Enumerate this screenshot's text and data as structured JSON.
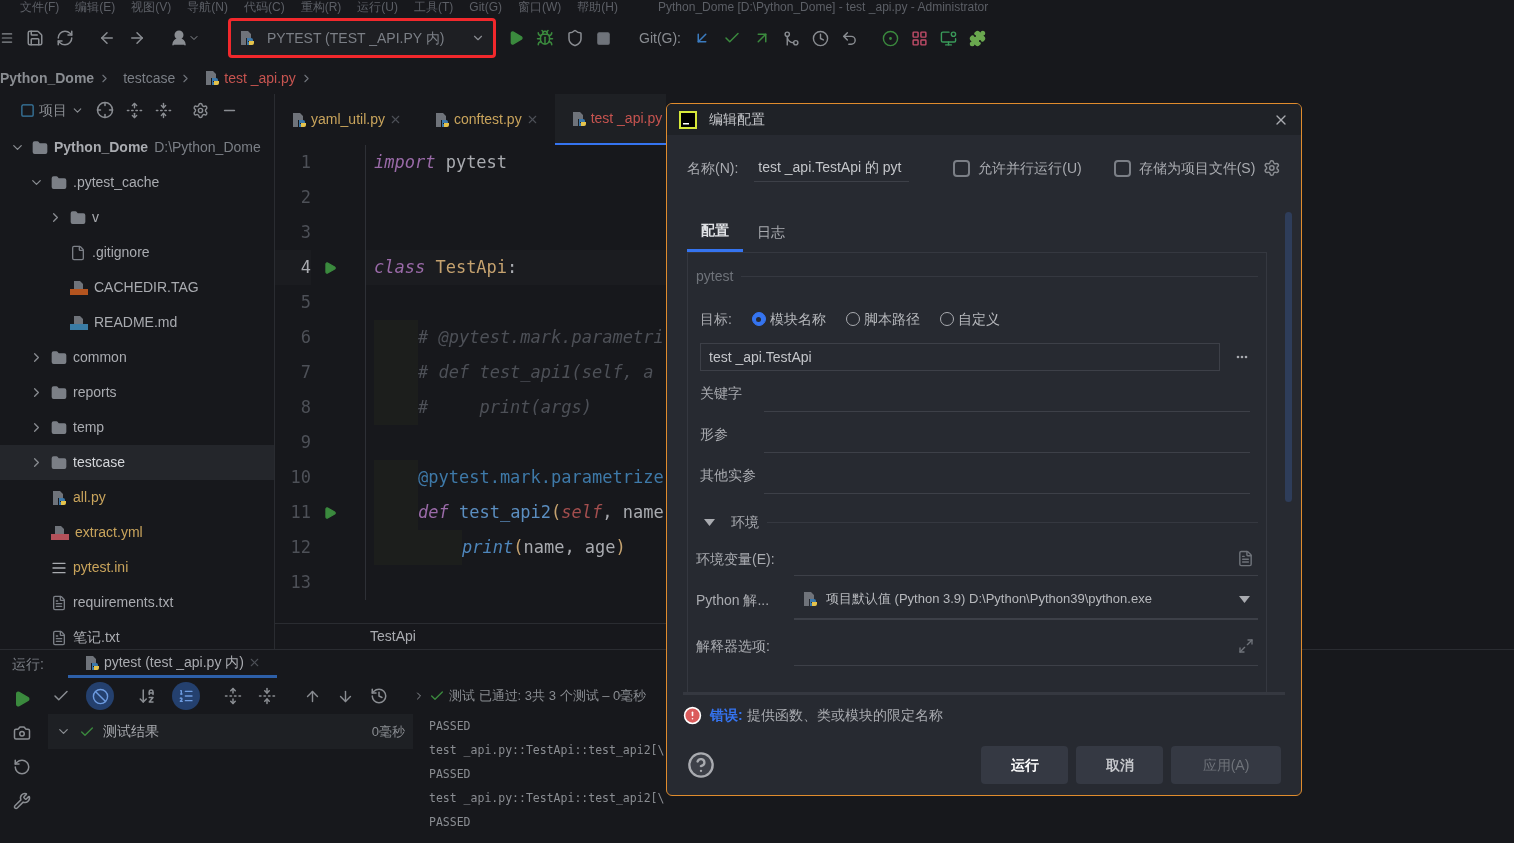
{
  "menu": {
    "items": [
      "文件(F)",
      "编辑(E)",
      "视图(V)",
      "导航(N)",
      "代码(C)",
      "重构(R)",
      "运行(U)",
      "工具(T)",
      "Git(G)",
      "窗口(W)",
      "帮助(H)"
    ],
    "title": "Python_Dome [D:\\Python_Dome] - test _api.py - Administrator"
  },
  "toolbar": {
    "run_config": {
      "label": "PYTEST (TEST _API.PY 内)",
      "highlighted": true
    },
    "git_label": "Git(G):"
  },
  "breadcrumbs": [
    {
      "label": "Python_Dome",
      "kind": "project"
    },
    {
      "label": "testcase",
      "kind": "folder"
    },
    {
      "label": "test _api.py",
      "kind": "file"
    }
  ],
  "project_panel": {
    "title": "项目",
    "tree": [
      {
        "name": "Python_Dome",
        "path": "D:\\Python_Dome",
        "kind": "root",
        "expanded": true,
        "selected": false,
        "children": [
          {
            "name": ".pytest_cache",
            "kind": "folder",
            "expanded": true,
            "selected": false,
            "children": [
              {
                "name": "v",
                "kind": "folder",
                "expanded": false,
                "selected": false
              },
              {
                "name": ".gitignore",
                "kind": "ignore",
                "color": "#a9abb0",
                "selected": false
              },
              {
                "name": "CACHEDIR.TAG",
                "kind": "jsp",
                "color": "#a9abb0",
                "selected": false
              },
              {
                "name": "README.md",
                "kind": "md",
                "color": "#a9abb0",
                "selected": false
              }
            ]
          },
          {
            "name": "common",
            "kind": "package",
            "expanded": false,
            "selected": false
          },
          {
            "name": "reports",
            "kind": "folder",
            "expanded": false,
            "selected": false
          },
          {
            "name": "temp",
            "kind": "package",
            "expanded": false,
            "selected": false
          },
          {
            "name": "testcase",
            "kind": "package",
            "expanded": false,
            "selected": true
          },
          {
            "name": "all.py",
            "kind": "python",
            "color": "#c9a45c",
            "selected": false
          },
          {
            "name": "extract.yml",
            "kind": "yml",
            "color": "#c9a45c",
            "selected": false
          },
          {
            "name": "pytest.ini",
            "kind": "ini",
            "color": "#c9a45c",
            "selected": false
          },
          {
            "name": "requirements.txt",
            "kind": "txt",
            "color": "#a9abb0",
            "selected": false
          },
          {
            "name": "笔记.txt",
            "kind": "txt",
            "color": "#a9abb0",
            "selected": false
          }
        ]
      }
    ]
  },
  "editor": {
    "tabs": [
      {
        "label": "yaml_util.py",
        "selected": false,
        "color": "#c9a45c"
      },
      {
        "label": "conftest.py",
        "selected": false,
        "color": "#c9a45c"
      },
      {
        "label": "test _api.py",
        "selected": true,
        "color": "#c75450"
      }
    ],
    "lines": [
      {
        "number": "1",
        "run": false,
        "current": false,
        "kind": "top",
        "tokens": [
          {
            "kind": "keyword",
            "text": "import"
          },
          {
            "kind": "plain",
            "text": " pytest"
          }
        ]
      },
      {
        "number": "2",
        "run": false,
        "current": false,
        "kind": "top"
      },
      {
        "number": "3",
        "run": false,
        "current": false,
        "kind": "top"
      },
      {
        "number": "4",
        "run": true,
        "current": true,
        "kind": "top",
        "tokens": [
          {
            "kind": "keyword",
            "text": "class"
          },
          {
            "kind": "class",
            "text": " TestApi"
          },
          {
            "kind": "plain",
            "text": ":"
          }
        ]
      },
      {
        "number": "5",
        "run": false,
        "current": false,
        "kind": "top"
      },
      {
        "number": "6",
        "run": false,
        "current": false,
        "kind": "block",
        "tokens": [
          {
            "kind": "comment",
            "text": "# @pytest.mark.parametri"
          }
        ]
      },
      {
        "number": "7",
        "run": false,
        "current": false,
        "kind": "block",
        "tokens": [
          {
            "kind": "comment",
            "text": "# def test_api1(self, a"
          }
        ]
      },
      {
        "number": "8",
        "run": false,
        "current": false,
        "kind": "block",
        "tokens": [
          {
            "kind": "comment",
            "text": "#     print(args)"
          }
        ]
      },
      {
        "number": "9",
        "run": false,
        "current": false,
        "kind": "top"
      },
      {
        "number": "10",
        "run": false,
        "current": false,
        "kind": "block",
        "tokens": [
          {
            "kind": "decorator",
            "text": "@pytest.mark.parametrize"
          }
        ]
      },
      {
        "number": "11",
        "run": true,
        "current": false,
        "kind": "block",
        "tokens": [
          {
            "kind": "keyword",
            "text": "def"
          },
          {
            "kind": "function",
            "text": " test_api2"
          },
          {
            "kind": "paren",
            "text": "("
          },
          {
            "kind": "self",
            "text": "self"
          },
          {
            "kind": "plain",
            "text": ", name"
          }
        ]
      },
      {
        "number": "12",
        "run": false,
        "current": false,
        "kind": "nested",
        "tokens": [
          {
            "kind": "builtin",
            "text": "print"
          },
          {
            "kind": "paren",
            "text": "("
          },
          {
            "kind": "plain",
            "text": "name, age"
          },
          {
            "kind": "paren",
            "text": ")"
          }
        ]
      },
      {
        "number": "13",
        "run": false,
        "current": false,
        "kind": "top"
      }
    ],
    "breadcrumb": "TestApi"
  },
  "run_panel": {
    "label": "运行:",
    "tab": {
      "label": "pytest (test _api.py 内)",
      "selected": true
    },
    "status": "测试 已通过: 3共 3 个测试 – 0毫秒",
    "results": {
      "label": "测试结果",
      "time": "0毫秒",
      "expanded": true
    },
    "output": [
      "PASSED",
      "test _api.py::TestApi::test_api2[\\",
      "PASSED",
      "test _api.py::TestApi::test_api2[\\",
      "PASSED"
    ]
  },
  "dialog": {
    "title": "编辑配置",
    "name_label": "名称(N):",
    "name_value": "test _api.TestApi 的 pyt",
    "options": [
      {
        "label": "允许并行运行(U)",
        "checked": false
      },
      {
        "label": "存储为项目文件(S)",
        "checked": false
      }
    ],
    "tabs": [
      {
        "label": "配置",
        "selected": true
      },
      {
        "label": "日志",
        "selected": false
      }
    ],
    "section": "pytest",
    "target_label": "目标:",
    "targets": [
      {
        "label": "模块名称",
        "selected": true
      },
      {
        "label": "脚本路径",
        "selected": false
      },
      {
        "label": "自定义",
        "selected": false
      }
    ],
    "target_value": "test _api.TestApi",
    "fields": [
      {
        "label": "关键字"
      },
      {
        "label": "形参"
      },
      {
        "label": "其他实参"
      }
    ],
    "env": {
      "label": "环境",
      "expanded": true,
      "variables_label": "环境变量(E):",
      "interpreter_label": "Python 解...",
      "interpreter_value": "项目默认值 (Python 3.9) D:\\Python\\Python39\\python.exe",
      "options_label": "解释器选项:"
    },
    "error": {
      "label": "错误:",
      "message": "提供函数、类或模块的限定名称"
    },
    "buttons": [
      {
        "label": "运行",
        "kind": "primary"
      },
      {
        "label": "取消",
        "kind": "normal"
      },
      {
        "label": "应用(A)",
        "kind": "disabled"
      }
    ]
  }
}
